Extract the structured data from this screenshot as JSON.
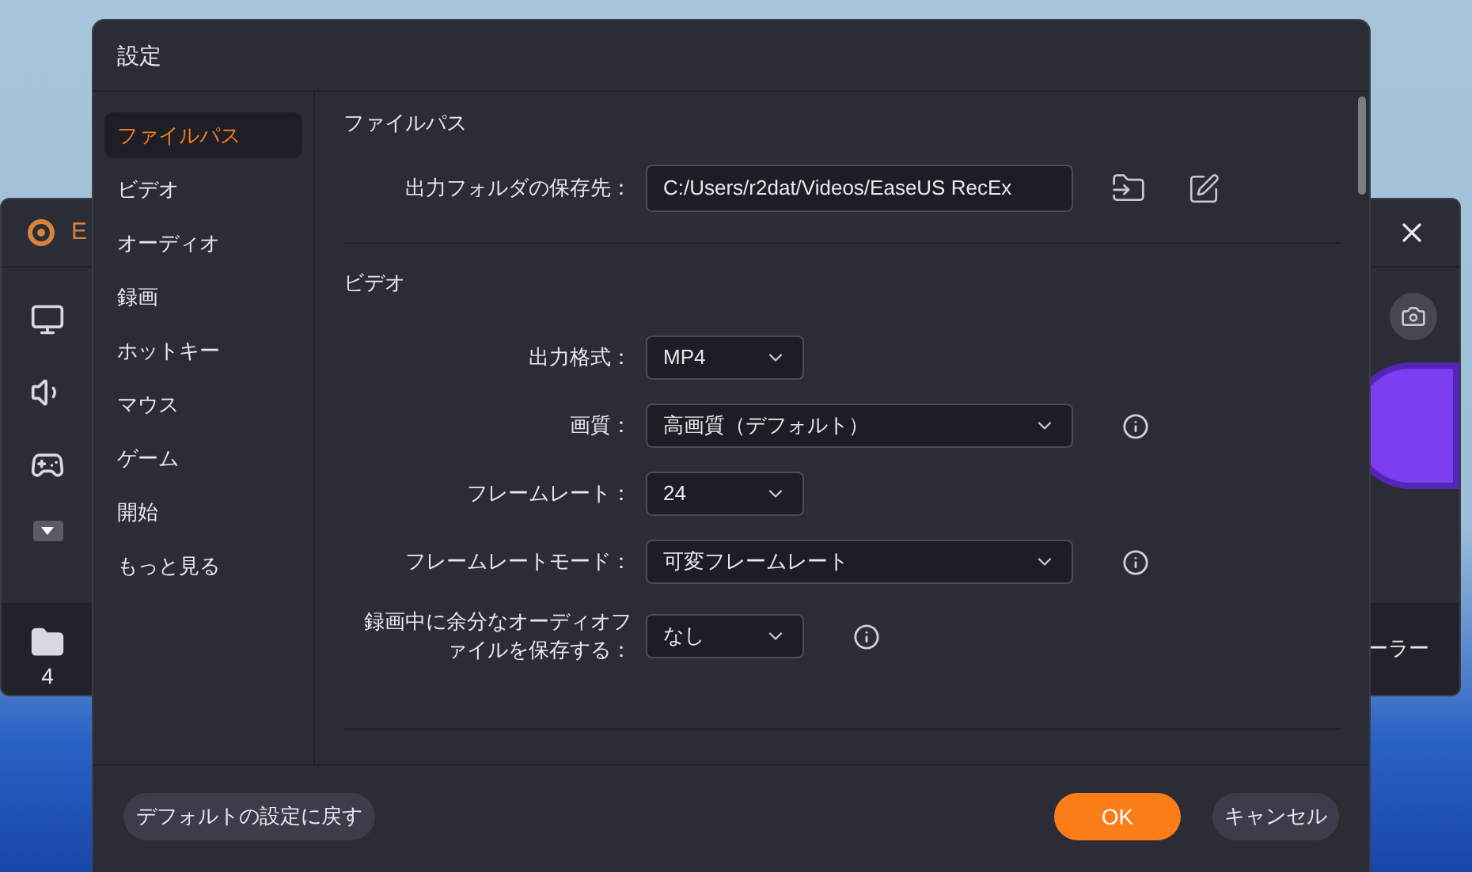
{
  "background_window": {
    "title": "E",
    "folder_count": "4",
    "cut_label": "ーラー"
  },
  "dialog": {
    "title": "設定",
    "sidebar": [
      {
        "label": "ファイルパス",
        "selected": true
      },
      {
        "label": "ビデオ",
        "selected": false
      },
      {
        "label": "オーディオ",
        "selected": false
      },
      {
        "label": "録画",
        "selected": false
      },
      {
        "label": "ホットキー",
        "selected": false
      },
      {
        "label": "マウス",
        "selected": false
      },
      {
        "label": "ゲーム",
        "selected": false
      },
      {
        "label": "開始",
        "selected": false
      },
      {
        "label": "もっと見る",
        "selected": false
      }
    ],
    "sections": [
      {
        "title": "ファイルパス",
        "rows": [
          {
            "kind": "path",
            "label": "出力フォルダの保存先：",
            "value": "C:/Users/r2dat/Videos/EaseUS RecEx"
          }
        ]
      },
      {
        "title": "ビデオ",
        "rows": [
          {
            "kind": "short-select",
            "label": "出力格式：",
            "value": "MP4",
            "info": false
          },
          {
            "kind": "long-select",
            "label": "画質：",
            "value": "高画質（デフォルト）",
            "info": true
          },
          {
            "kind": "short-select",
            "label": "フレームレート：",
            "value": "24",
            "info": false
          },
          {
            "kind": "long-select",
            "label": "フレームレートモード：",
            "value": "可変フレームレート",
            "info": true
          },
          {
            "kind": "short-select",
            "label": "録画中に余分なオーディオファイルを保存する：",
            "value": "なし",
            "info": true
          }
        ]
      }
    ],
    "footer": {
      "reset": "デフォルトの設定に戻す",
      "ok": "OK",
      "cancel": "キャンセル"
    }
  }
}
